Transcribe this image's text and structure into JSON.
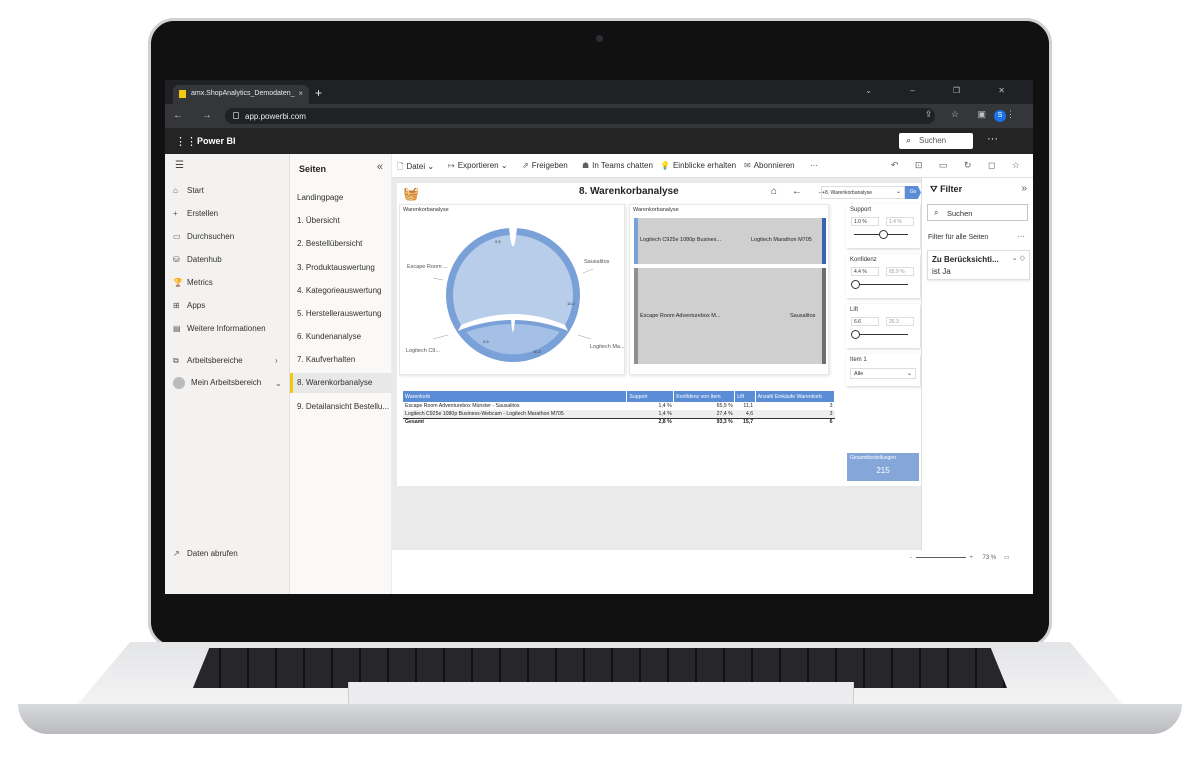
{
  "browser": {
    "tab_title": "amx.ShopAnalytics_Demodaten_",
    "tab_close": "×",
    "new_tab": "+",
    "window_controls": "⌄ – ❐ ✕",
    "nav_buttons": "← → ↻",
    "url": "app.powerbi.com",
    "right_icons": "⇪ ☆ ▣",
    "profile_initial": "S",
    "menu": "⋮"
  },
  "app": {
    "name": "Power BI",
    "search_placeholder": "Suchen",
    "more": "···"
  },
  "leftnav": {
    "items": [
      {
        "icon": "⌂",
        "label": "Start"
      },
      {
        "icon": "+",
        "label": "Erstellen"
      },
      {
        "icon": "▭",
        "label": "Durchsuchen"
      },
      {
        "icon": "⛁",
        "label": "Datenhub"
      },
      {
        "icon": "🏆",
        "label": "Metrics"
      },
      {
        "icon": "⊞",
        "label": "Apps"
      },
      {
        "icon": "▤",
        "label": "Weitere Informationen"
      }
    ],
    "workspaces": {
      "icon": "⧉",
      "label": "Arbeitsbereiche",
      "chevron": "›"
    },
    "my_workspace": {
      "label": "Mein Arbeitsbereich",
      "chevron": "⌄"
    },
    "get_data": {
      "icon": "↗",
      "label": "Daten abrufen"
    }
  },
  "pages": {
    "title": "Seiten",
    "collapse": "«",
    "items": [
      "Landingpage",
      "1. Übersicht",
      "2. Bestellübersicht",
      "3. Produktauswertung",
      "4. Kategorieauswertung",
      "5. Herstellerauswertung",
      "6. Kundenanalyse",
      "7. Kaufverhalten",
      "8. Warenkorbanalyse",
      "9. Detailansicht Bestellu..."
    ],
    "active_index": 8
  },
  "actionbar": {
    "file": "Datei",
    "export": "Exportieren",
    "share": "Freigeben",
    "teams": "In Teams chatten",
    "insights": "Einblicke erhalten",
    "subscribe": "Abonnieren",
    "more": "···",
    "right_icons": "↶ ⊡ ▭ ↻ ◻ ☆"
  },
  "report": {
    "title": "8. Warenkorbanalyse",
    "nav": "⌂ ← →",
    "page_select": "8. Warenkorbanalyse",
    "go": "Go",
    "chord": {
      "title": "Warenkorbanalyse",
      "labels": {
        "escape": "Escape Room ...",
        "sausalitos": "Sausalitos",
        "logitech_c9": "Logitech C9...",
        "logitech_ma": "Logitech Ma..."
      },
      "ticks": [
        "0.5",
        "10.2",
        "0.5",
        "10.2"
      ]
    },
    "sankey": {
      "title": "Warenkorbanalyse",
      "rows": [
        {
          "left": "Logitech C925e 1080p Busines...",
          "right": "Logitech Marathon M705"
        },
        {
          "left": "Escape Room Adventurebox M...",
          "right": "Sausalitos"
        }
      ]
    },
    "slicers": {
      "support": {
        "title": "Support",
        "min": "1.0 %",
        "max": "1.4 %"
      },
      "konfidenz": {
        "title": "Konfidenz",
        "min": "4.4 %",
        "max": "65.9 %"
      },
      "lift": {
        "title": "Lift",
        "min": "6.6",
        "max": "26.3"
      },
      "item": {
        "title": "Item 1",
        "value": "Alle"
      }
    },
    "card": {
      "label": "Gesamtbestellungen",
      "value": "215"
    },
    "table": {
      "headers": [
        "Warenkorb",
        "Support",
        "Konfidenz von Item",
        "Lift",
        "Anzahl Einkäufe Warenkorb"
      ],
      "rows": [
        [
          "Escape Room Adventurebox Münster - Sausalitos",
          "1,4 %",
          "65,9 %",
          "11,1",
          "3"
        ],
        [
          "Logitech C925e 1080p Business-Webcam - Logitech Marathon M705",
          "1,4 %",
          "27,4 %",
          "4,6",
          "3"
        ]
      ],
      "total": [
        "Gesamt",
        "2,8 %",
        "93,3 %",
        "15,7",
        "6"
      ]
    }
  },
  "filter": {
    "title": "Filter",
    "collapse": "»",
    "search_placeholder": "Suchen",
    "all_pages": "Filter für alle Seiten",
    "dots": "···",
    "card_title": "Zu Berücksichti...",
    "card_value": "ist Ja",
    "card_icons": "⌄ ◇"
  },
  "zoom": {
    "minus": "-",
    "plus": "+",
    "level": "73 %",
    "fit": "▭"
  },
  "colors": {
    "accent": "#f2c811",
    "chart_blue": "#5b8dd6",
    "chart_light": "#9fbbe3"
  }
}
